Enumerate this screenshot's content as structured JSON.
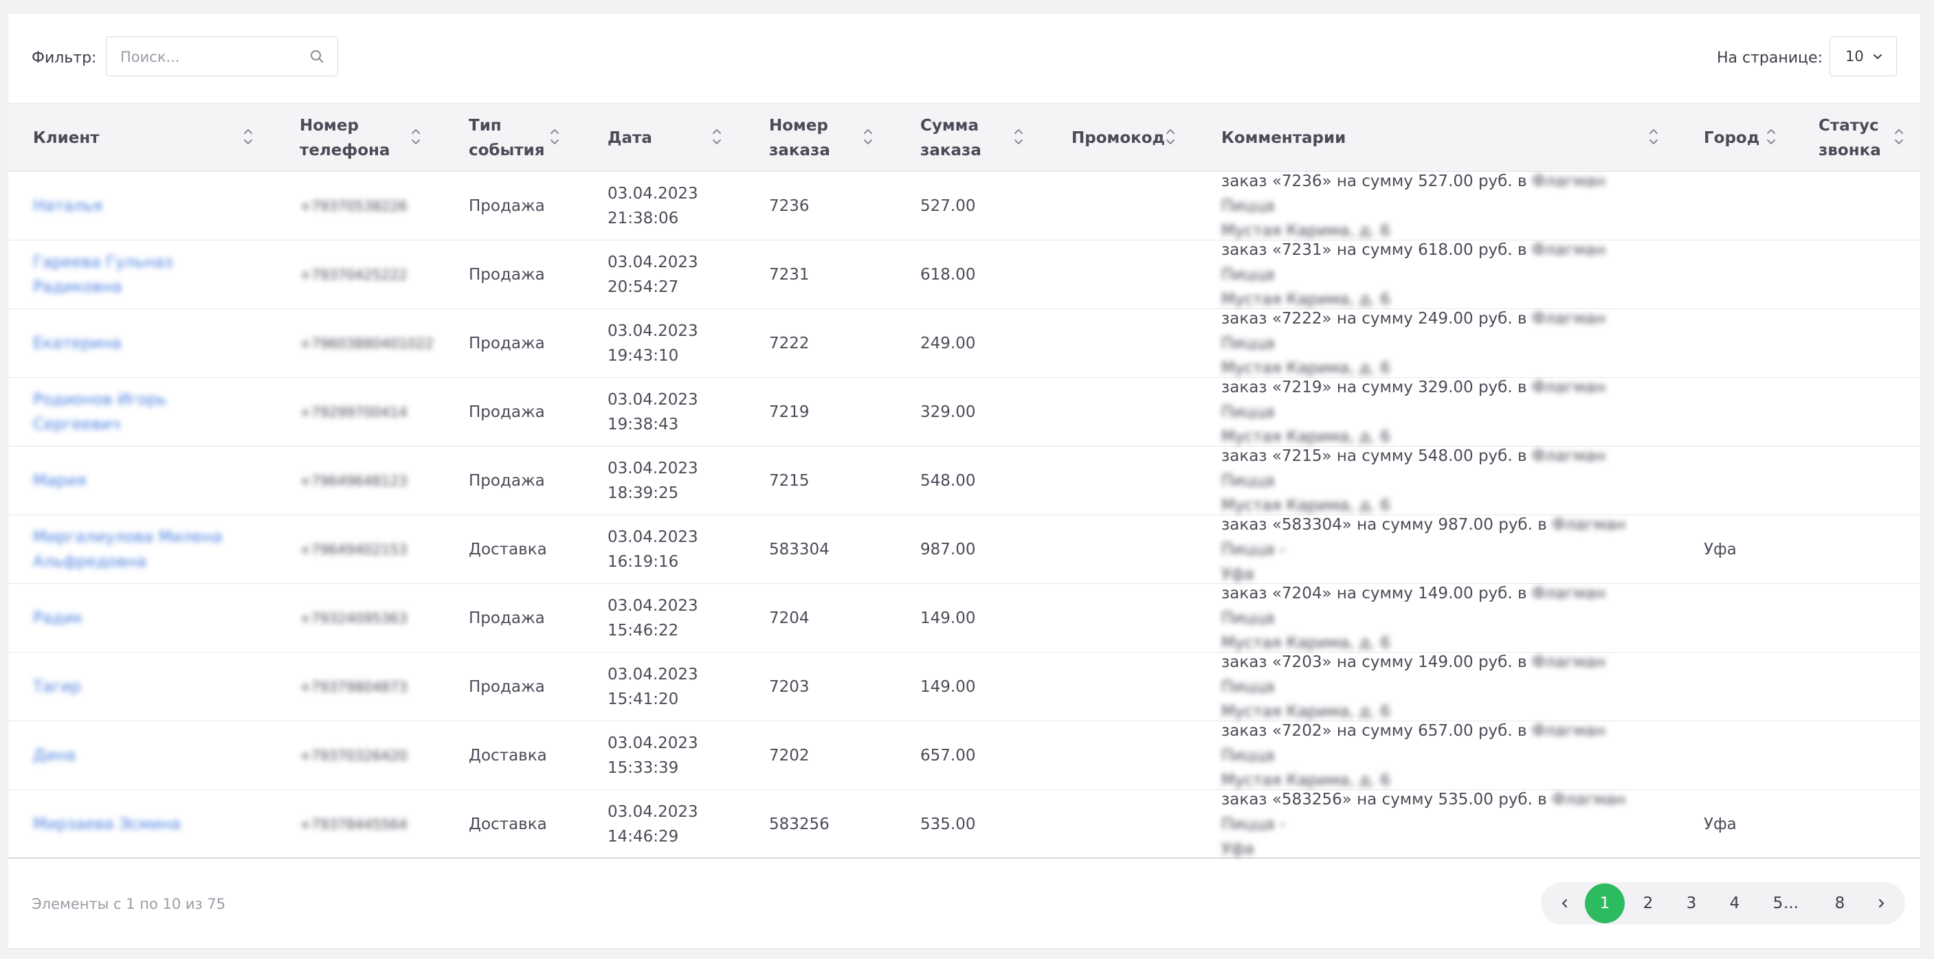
{
  "toolbar": {
    "filter_label": "Фильтр:",
    "search_placeholder": "Поиск...",
    "per_page_label": "На странице:",
    "per_page_value": "10"
  },
  "columns": [
    {
      "key": "client",
      "label": "Клиент"
    },
    {
      "key": "phone",
      "label": "Номер телефона"
    },
    {
      "key": "event_type",
      "label": "Тип события"
    },
    {
      "key": "date",
      "label": "Дата"
    },
    {
      "key": "order_number",
      "label": "Номер заказа"
    },
    {
      "key": "order_sum",
      "label": "Сумма заказа"
    },
    {
      "key": "promo",
      "label": "Промокод"
    },
    {
      "key": "comment",
      "label": "Комментарии"
    },
    {
      "key": "city",
      "label": "Город"
    },
    {
      "key": "call_status",
      "label": "Статус звонка"
    }
  ],
  "header_lines": {
    "client": [
      "Клиент"
    ],
    "phone": [
      "Номер",
      "телефона"
    ],
    "event_type": [
      "Тип",
      "события"
    ],
    "date": [
      "Дата"
    ],
    "order_number": [
      "Номер",
      "заказа"
    ],
    "order_sum": [
      "Сумма",
      "заказа"
    ],
    "promo": [
      "Промокод"
    ],
    "comment": [
      "Комментарии"
    ],
    "city": [
      "Город"
    ],
    "call_status": [
      "Статус",
      "звонка"
    ]
  },
  "rows": [
    {
      "client": [
        "Наталья"
      ],
      "phone": "+79370538226",
      "event_type": "Продажа",
      "date": "03.04.2023",
      "time": "21:38:06",
      "order_number": "7236",
      "order_sum": "527.00",
      "comment_visible": "заказ «7236» на сумму 527.00 руб. в",
      "comment_hidden": [
        "Флагман Пицца",
        "Мустая Карима, д. 6"
      ],
      "city": "",
      "call_status": ""
    },
    {
      "client": [
        "Гареева Гульназ Радиковна"
      ],
      "phone": "+79370425222",
      "event_type": "Продажа",
      "date": "03.04.2023",
      "time": "20:54:27",
      "order_number": "7231",
      "order_sum": "618.00",
      "comment_visible": "заказ «7231» на сумму 618.00 руб. в",
      "comment_hidden": [
        "Флагман Пицца",
        "Мустая Карима, д. 6"
      ],
      "city": "",
      "call_status": ""
    },
    {
      "client": [
        "Екатерина"
      ],
      "phone": "+79603880401022",
      "event_type": "Продажа",
      "date": "03.04.2023",
      "time": "19:43:10",
      "order_number": "7222",
      "order_sum": "249.00",
      "comment_visible": "заказ «7222» на сумму 249.00 руб. в",
      "comment_hidden": [
        "Флагман Пицца",
        "Мустая Карима, д. 6"
      ],
      "city": "",
      "call_status": ""
    },
    {
      "client": [
        "Родионов Игорь Сергеевич"
      ],
      "phone": "+79299700414",
      "event_type": "Продажа",
      "date": "03.04.2023",
      "time": "19:38:43",
      "order_number": "7219",
      "order_sum": "329.00",
      "comment_visible": "заказ «7219» на сумму 329.00 руб. в",
      "comment_hidden": [
        "Флагман Пицца",
        "Мустая Карима, д. 6"
      ],
      "city": "",
      "call_status": ""
    },
    {
      "client": [
        "Мария"
      ],
      "phone": "+79649648123",
      "event_type": "Продажа",
      "date": "03.04.2023",
      "time": "18:39:25",
      "order_number": "7215",
      "order_sum": "548.00",
      "comment_visible": "заказ «7215» на сумму 548.00 руб. в",
      "comment_hidden": [
        "Флагман Пицца",
        "Мустая Карима, д. 6"
      ],
      "city": "",
      "call_status": ""
    },
    {
      "client": [
        "Миргалиулова Милена",
        "Альфредовна"
      ],
      "phone": "+79649402153",
      "event_type": "Доставка",
      "date": "03.04.2023",
      "time": "16:19:16",
      "order_number": "583304",
      "order_sum": "987.00",
      "comment_visible": "заказ «583304» на сумму 987.00 руб. в",
      "comment_hidden": [
        "Флагман Пицца -",
        "Уфа"
      ],
      "city": "Уфа",
      "call_status": ""
    },
    {
      "client": [
        "Радик"
      ],
      "phone": "+79324095363",
      "event_type": "Продажа",
      "date": "03.04.2023",
      "time": "15:46:22",
      "order_number": "7204",
      "order_sum": "149.00",
      "comment_visible": "заказ «7204» на сумму 149.00 руб. в",
      "comment_hidden": [
        "Флагман Пицца",
        "Мустая Карима, д. 6"
      ],
      "city": "",
      "call_status": ""
    },
    {
      "client": [
        "Тагир"
      ],
      "phone": "+79379804873",
      "event_type": "Продажа",
      "date": "03.04.2023",
      "time": "15:41:20",
      "order_number": "7203",
      "order_sum": "149.00",
      "comment_visible": "заказ «7203» на сумму 149.00 руб. в",
      "comment_hidden": [
        "Флагман Пицца",
        "Мустая Карима, д. 6"
      ],
      "city": "",
      "call_status": ""
    },
    {
      "client": [
        "Дина"
      ],
      "phone": "+79370326420",
      "event_type": "Доставка",
      "date": "03.04.2023",
      "time": "15:33:39",
      "order_number": "7202",
      "order_sum": "657.00",
      "comment_visible": "заказ «7202» на сумму 657.00 руб. в",
      "comment_hidden": [
        "Флагман Пицца",
        "Мустая Карима, д. 6"
      ],
      "city": "",
      "call_status": ""
    },
    {
      "client": [
        "Мирзаева Эсмина"
      ],
      "phone": "+79378445564",
      "event_type": "Доставка",
      "date": "03.04.2023",
      "time": "14:46:29",
      "order_number": "583256",
      "order_sum": "535.00",
      "comment_visible": "заказ «583256» на сумму 535.00 руб. в",
      "comment_hidden": [
        "Флагман Пицца -",
        "Уфа"
      ],
      "city": "Уфа",
      "call_status": ""
    }
  ],
  "footer": {
    "info": "Элементы с 1 по 10 из 75"
  },
  "pagination": {
    "prev_icon": "chevron-left-icon",
    "next_icon": "chevron-right-icon",
    "pages": [
      "1",
      "2",
      "3",
      "4",
      "5",
      "...",
      "8"
    ],
    "active": "1"
  },
  "colors": {
    "accent": "#2dbb5f",
    "link": "#4a7fe0",
    "header_bg": "#f4f4f7"
  }
}
